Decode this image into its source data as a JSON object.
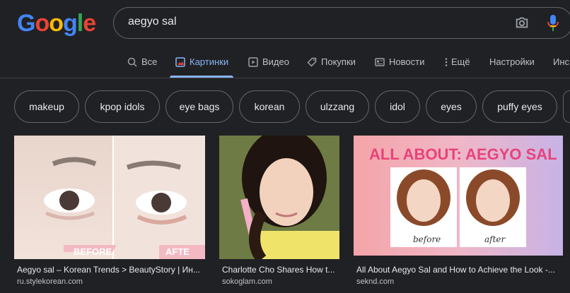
{
  "logo": {
    "letters": [
      "G",
      "o",
      "o",
      "g",
      "l",
      "e"
    ],
    "colors": [
      "#4285f4",
      "#ea4335",
      "#fbbc05",
      "#4285f4",
      "#34a853",
      "#ea4335"
    ]
  },
  "search": {
    "query": "aegyo sal"
  },
  "tabs": [
    {
      "label": "Все",
      "icon": "search-icon"
    },
    {
      "label": "Картинки",
      "icon": "image-icon",
      "active": true
    },
    {
      "label": "Видео",
      "icon": "video-icon"
    },
    {
      "label": "Покупки",
      "icon": "tag-icon"
    },
    {
      "label": "Новости",
      "icon": "news-icon"
    },
    {
      "label": "Ещё",
      "icon": "more-vertical-icon"
    },
    {
      "label": "Настройки"
    },
    {
      "label": "Инс"
    }
  ],
  "chips": [
    "makeup",
    "kpop idols",
    "eye bags",
    "korean",
    "ulzzang",
    "idol",
    "eyes",
    "puffy eyes"
  ],
  "results": [
    {
      "caption": "Aegyo sal – Korean Trends > BeautyStory | Ин...",
      "source": "ru.stylekorean.com",
      "overlay": [
        "BEFORE",
        "AFTE"
      ]
    },
    {
      "caption": "Charlotte Cho Shares How t...",
      "source": "sokoglam.com"
    },
    {
      "caption": "All About Aegyo Sal and How to Achieve the Look -...",
      "source": "seknd.com",
      "overlay": [
        "ALL ABOUT: AEGYO SAL",
        "before",
        "after"
      ]
    }
  ],
  "colors": {
    "accent": "#8ab4f8",
    "background": "#202124"
  }
}
